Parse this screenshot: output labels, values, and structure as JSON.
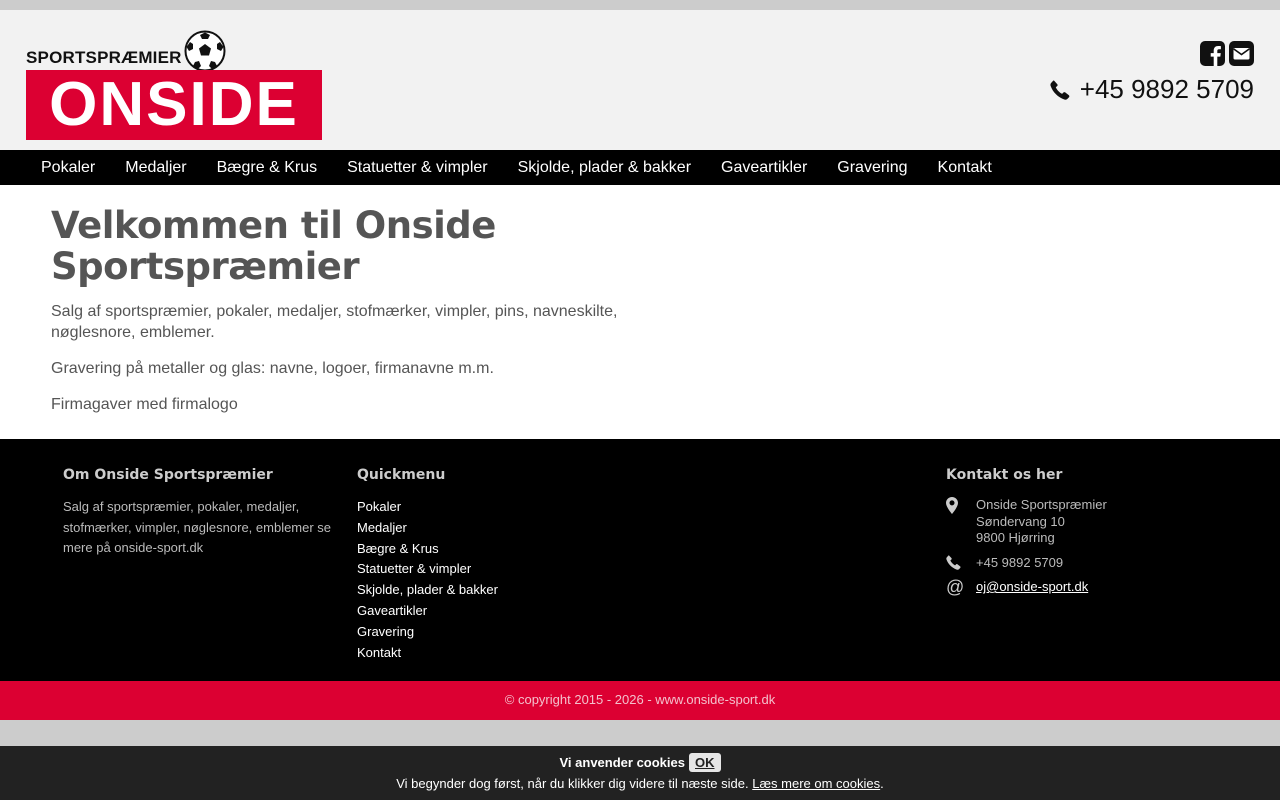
{
  "header": {
    "logo": {
      "top_text": "SPORTSPRÆMIER",
      "main_text": "ONSIDE"
    },
    "phone": "+45 9892 5709",
    "social_icons": [
      "facebook-square-icon",
      "envelope-square-icon"
    ]
  },
  "nav": {
    "items": [
      "Pokaler",
      "Medaljer",
      "Bægre & Krus",
      "Statuetter & vimpler",
      "Skjolde, plader & bakker",
      "Gaveartikler",
      "Gravering",
      "Kontakt"
    ]
  },
  "main": {
    "title": "Velkommen til Onside Sportspræmier",
    "paragraphs": [
      "Salg af sportspræmier, pokaler, medaljer, stofmærker, vimpler, pins, navneskilte, nøglesnore, emblemer.",
      "Gravering på metaller og glas: navne, logoer, firmanavne m.m.",
      "Firmagaver med firmalogo"
    ]
  },
  "footer": {
    "about": {
      "heading": "Om Onside Sportspræmier",
      "text": "Salg af sportspræmier, pokaler, medaljer, stofmærker, vimpler, nøglesnore, emblemer se mere på onside-sport.dk"
    },
    "quickmenu": {
      "heading": "Quickmenu",
      "items": [
        "Pokaler",
        "Medaljer",
        "Bægre & Krus",
        "Statuetter & vimpler",
        "Skjolde, plader & bakker",
        "Gaveartikler",
        "Gravering",
        "Kontakt"
      ]
    },
    "contact": {
      "heading": "Kontakt os her",
      "address": [
        "Onside Sportspræmier",
        "Søndervang 10",
        "9800 Hjørring"
      ],
      "phone": "+45 9892 5709",
      "email": "oj@onside-sport.dk"
    }
  },
  "copyright": "© copyright 2015 - 2026 - www.onside-sport.dk",
  "cookie": {
    "title": "Vi anvender cookies",
    "ok_label": "OK",
    "message": "Vi begynder dog først, når du klikker dig videre til næste side.",
    "link_label": "Læs mere om cookies",
    "trailing": "."
  },
  "colors": {
    "brand_red": "#dc0032",
    "nav_bg": "#000000",
    "header_bg": "#f2f2f2"
  }
}
